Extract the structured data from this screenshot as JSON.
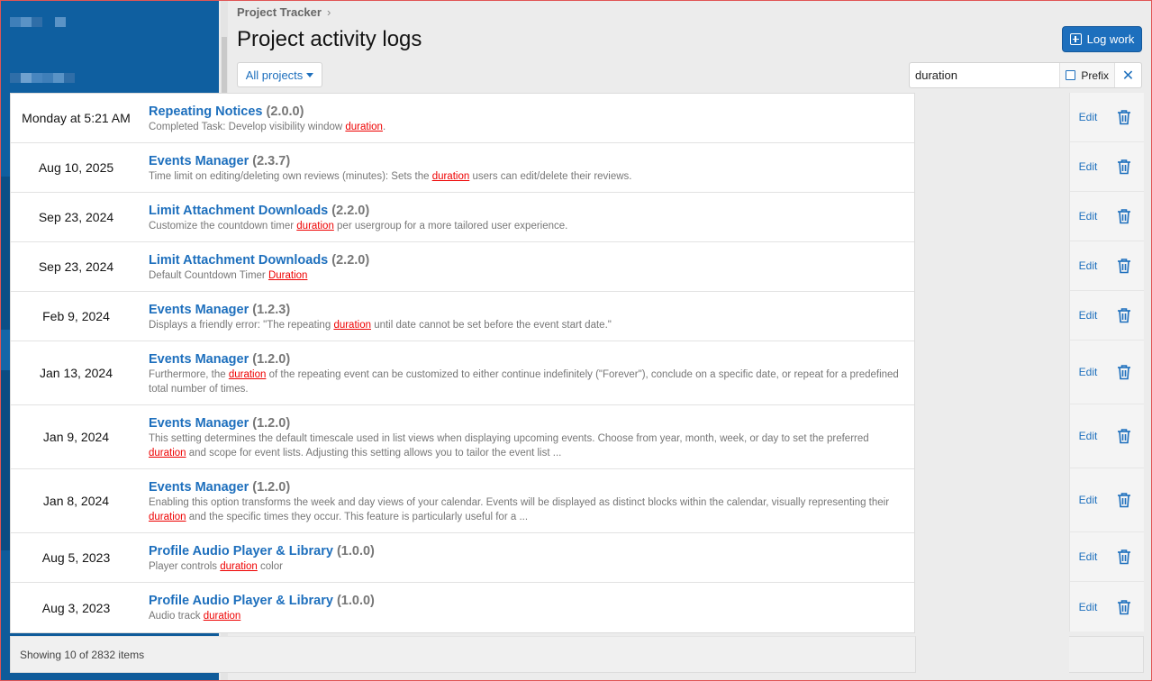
{
  "breadcrumb": {
    "label": "Project Tracker",
    "separator": "›"
  },
  "page": {
    "title": "Project activity logs"
  },
  "actions": {
    "log_work_label": "Log work"
  },
  "filter": {
    "label": "All projects"
  },
  "search": {
    "value": "duration",
    "prefix_label": "Prefix",
    "clear_label": "✕"
  },
  "list_actions": {
    "edit_label": "Edit"
  },
  "rows": [
    {
      "date": "Monday at 5:21 AM",
      "name": "Repeating Notices",
      "version": "(2.0.0)",
      "desc_before": "Completed Task: Develop visibility window ",
      "hl": "duration",
      "desc_after": "."
    },
    {
      "date": "Aug 10, 2025",
      "name": "Events Manager",
      "version": "(2.3.7)",
      "desc_before": "Time limit on editing/deleting own reviews (minutes): Sets the ",
      "hl": "duration",
      "desc_after": " users can edit/delete their reviews."
    },
    {
      "date": "Sep 23, 2024",
      "name": "Limit Attachment Downloads",
      "version": "(2.2.0)",
      "desc_before": "Customize the countdown timer ",
      "hl": "duration",
      "desc_after": " per usergroup for a more tailored user experience."
    },
    {
      "date": "Sep 23, 2024",
      "name": "Limit Attachment Downloads",
      "version": "(2.2.0)",
      "desc_before": "Default Countdown Timer ",
      "hl": "Duration",
      "desc_after": ""
    },
    {
      "date": "Feb 9, 2024",
      "name": "Events Manager",
      "version": "(1.2.3)",
      "desc_before": "Displays a friendly error: \"The repeating ",
      "hl": "duration",
      "desc_after": " until date cannot be set before the event start date.\""
    },
    {
      "date": "Jan 13, 2024",
      "name": "Events Manager",
      "version": "(1.2.0)",
      "desc_before": "Furthermore, the ",
      "hl": "duration",
      "desc_after": " of the repeating event can be customized to either continue indefinitely (\"Forever\"), conclude on a specific date, or repeat for a predefined total number of times."
    },
    {
      "date": "Jan 9, 2024",
      "name": "Events Manager",
      "version": "(1.2.0)",
      "desc_before": "This setting determines the default timescale used in list views when displaying upcoming events. Choose from year, month, week, or day to set the preferred ",
      "hl": "duration",
      "desc_after": " and scope for event lists. Adjusting this setting allows you to tailor the event list ..."
    },
    {
      "date": "Jan 8, 2024",
      "name": "Events Manager",
      "version": "(1.2.0)",
      "desc_before": "Enabling this option transforms the week and day views of your calendar. Events will be displayed as distinct blocks within the calendar, visually representing their ",
      "hl": "duration",
      "desc_after": " and the specific times they occur. This feature is particularly useful for a ..."
    },
    {
      "date": "Aug 5, 2023",
      "name": "Profile Audio Player & Library",
      "version": "(1.0.0)",
      "desc_before": "Player controls ",
      "hl": "duration",
      "desc_after": " color"
    },
    {
      "date": "Aug 3, 2023",
      "name": "Profile Audio Player & Library",
      "version": "(1.0.0)",
      "desc_before": "Audio track ",
      "hl": "duration",
      "desc_after": ""
    }
  ],
  "footer": {
    "summary": "Showing 10 of 2832 items"
  },
  "colors": {
    "accent": "#1d6fbd",
    "highlight": "#e00000",
    "sidebar": "#0e5b9a"
  }
}
